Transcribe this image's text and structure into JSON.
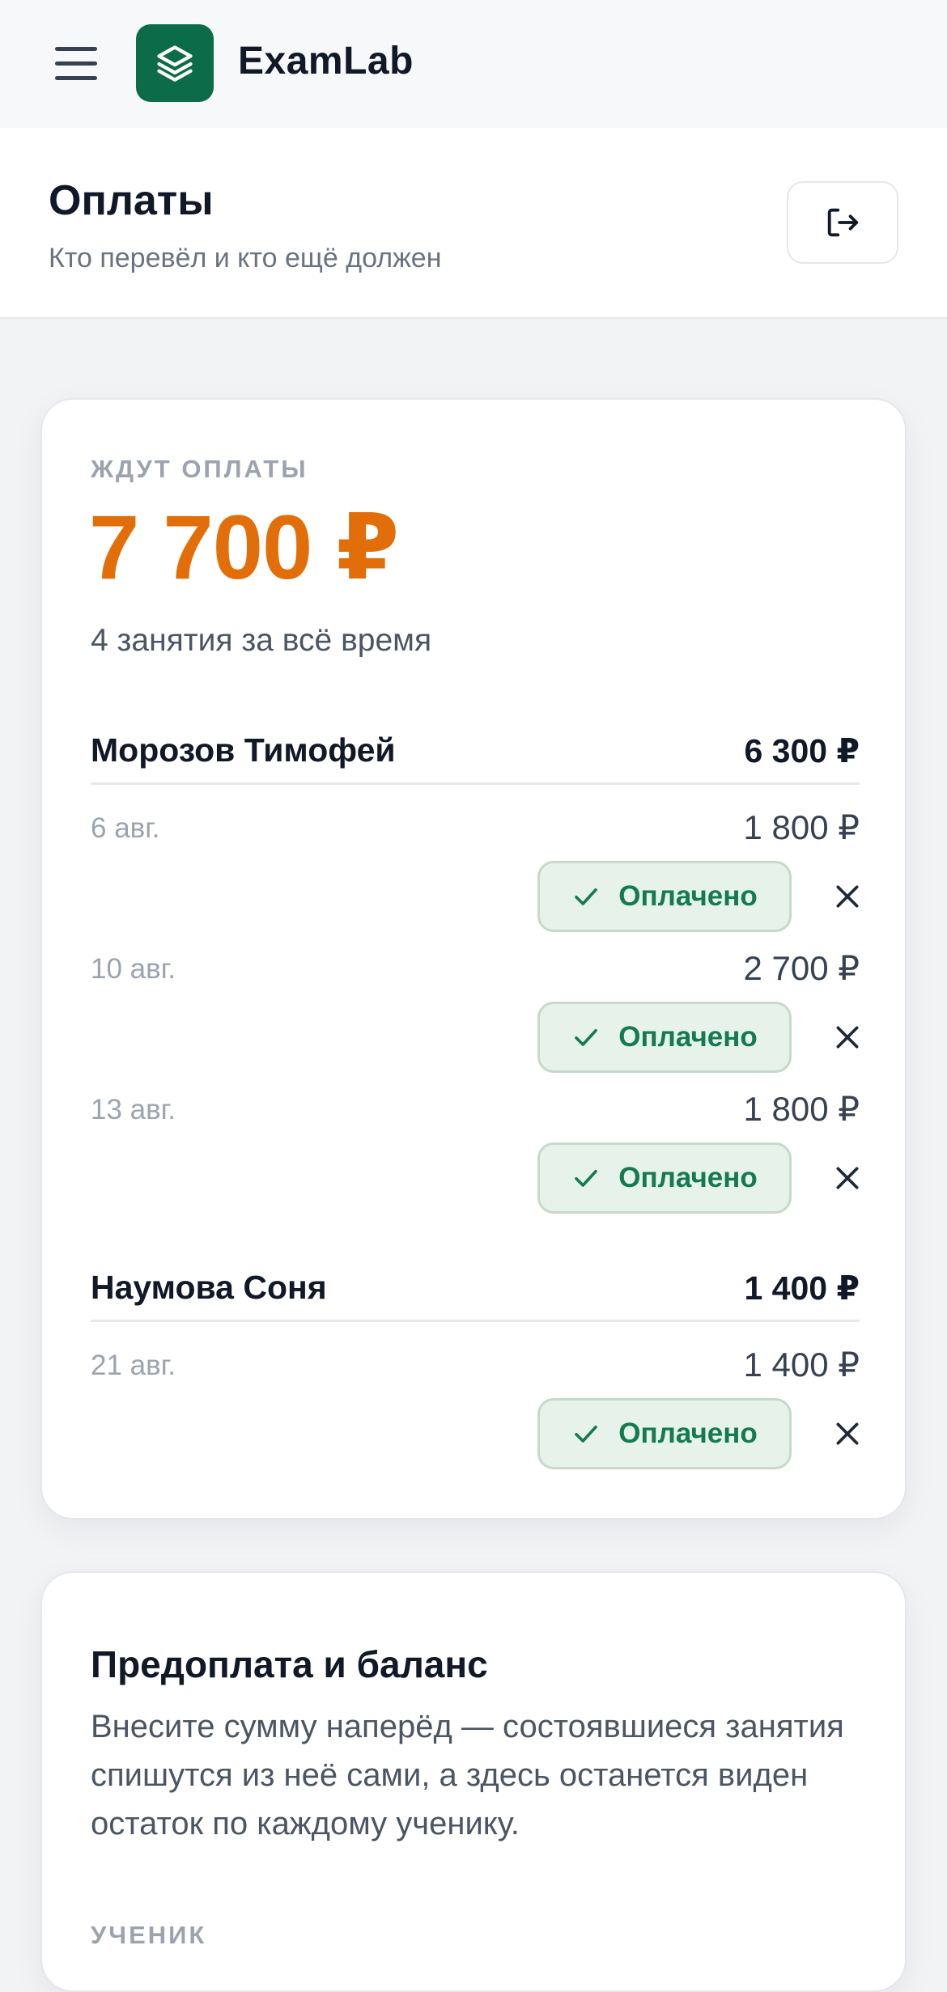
{
  "app": {
    "name": "ExamLab"
  },
  "header": {
    "title": "Оплаты",
    "subtitle": "Кто перевёл и кто ещё должен"
  },
  "pending": {
    "eyebrow": "ЖДУТ ОПЛАТЫ",
    "total": "7 700 ₽",
    "summary": "4 занятия за всё время",
    "students": [
      {
        "name": "Морозов Тимофей",
        "total": "6 300 ₽",
        "lessons": [
          {
            "date": "6 авг.",
            "amount": "1 800 ₽",
            "paid_label": "Оплачено"
          },
          {
            "date": "10 авг.",
            "amount": "2 700 ₽",
            "paid_label": "Оплачено"
          },
          {
            "date": "13 авг.",
            "amount": "1 800 ₽",
            "paid_label": "Оплачено"
          }
        ]
      },
      {
        "name": "Наумова Соня",
        "total": "1 400 ₽",
        "lessons": [
          {
            "date": "21 авг.",
            "amount": "1 400 ₽",
            "paid_label": "Оплачено"
          }
        ]
      }
    ]
  },
  "prepay": {
    "title": "Предоплата и баланс",
    "description": "Внесите сумму наперёд — состоявшиеся занятия спишутся из неё сами, а здесь останется виден остаток по каждому ученику.",
    "field_label": "УЧЕНИК"
  },
  "colors": {
    "brand": "#0c6b48",
    "pending_total": "#e26e0a",
    "paid": "#147a4f"
  },
  "icons": {
    "menu": "hamburger-icon",
    "logo": "layers-icon",
    "logout": "logout-icon",
    "paid": "check-icon",
    "dismiss": "close-icon"
  }
}
